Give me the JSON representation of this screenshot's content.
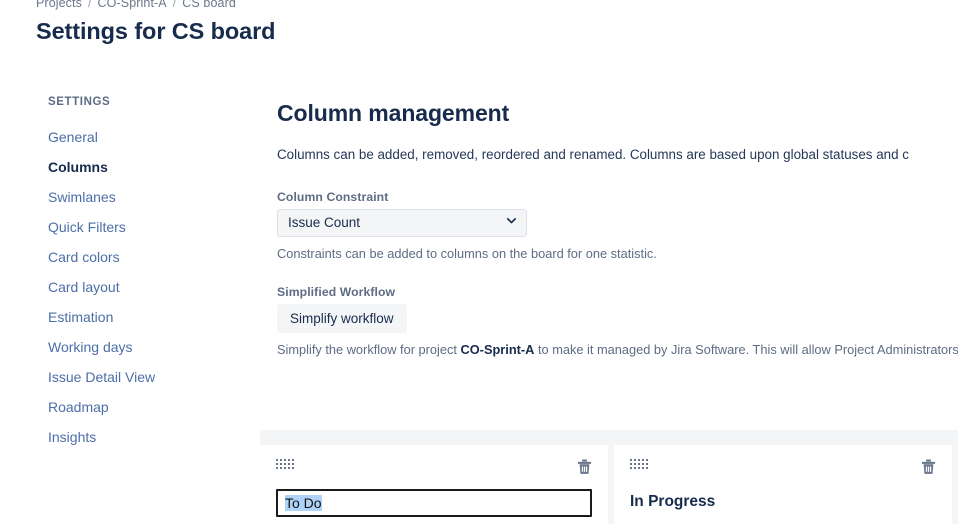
{
  "breadcrumb": {
    "items": [
      {
        "label": "Projects"
      },
      {
        "label": "CO-Sprint-A"
      },
      {
        "label": "CS board"
      }
    ],
    "separator": "/"
  },
  "page_title": "Settings for CS board",
  "sidebar": {
    "heading": "SETTINGS",
    "items": [
      {
        "label": "General",
        "active": false
      },
      {
        "label": "Columns",
        "active": true
      },
      {
        "label": "Swimlanes",
        "active": false
      },
      {
        "label": "Quick Filters",
        "active": false
      },
      {
        "label": "Card colors",
        "active": false
      },
      {
        "label": "Card layout",
        "active": false
      },
      {
        "label": "Estimation",
        "active": false
      },
      {
        "label": "Working days",
        "active": false
      },
      {
        "label": "Issue Detail View",
        "active": false
      },
      {
        "label": "Roadmap",
        "active": false
      },
      {
        "label": "Insights",
        "active": false
      }
    ]
  },
  "main": {
    "section_title": "Column management",
    "section_description": "Columns can be added, removed, reordered and renamed. Columns are based upon global statuses and c",
    "column_constraint": {
      "label": "Column Constraint",
      "selected": "Issue Count",
      "options": [
        "Issue Count"
      ],
      "help": "Constraints can be added to columns on the board for one statistic.",
      "chevron_icon": "chevron-down-icon"
    },
    "simplified_workflow": {
      "label": "Simplified Workflow",
      "button_label": "Simplify workflow",
      "help_prefix": "Simplify the workflow for project ",
      "help_project": "CO-Sprint-A",
      "help_suffix": " to make it managed by Jira Software. This will allow Project Administrators"
    }
  },
  "columns": [
    {
      "title": "To Do",
      "editing": true,
      "drag_icon": "drag-handle-icon",
      "delete_icon": "trash-icon"
    },
    {
      "title": "In Progress",
      "editing": false,
      "drag_icon": "drag-handle-icon",
      "delete_icon": "trash-icon"
    },
    {
      "title": "",
      "editing": false,
      "drag_icon": "drag-handle-icon",
      "delete_icon": "trash-icon"
    }
  ],
  "colors": {
    "link": "#4C6EA8",
    "text_dark": "#172B4D",
    "text_muted": "#5E6C84",
    "surface_subtle": "#F4F5F7",
    "selection": "#AFD2F8"
  }
}
